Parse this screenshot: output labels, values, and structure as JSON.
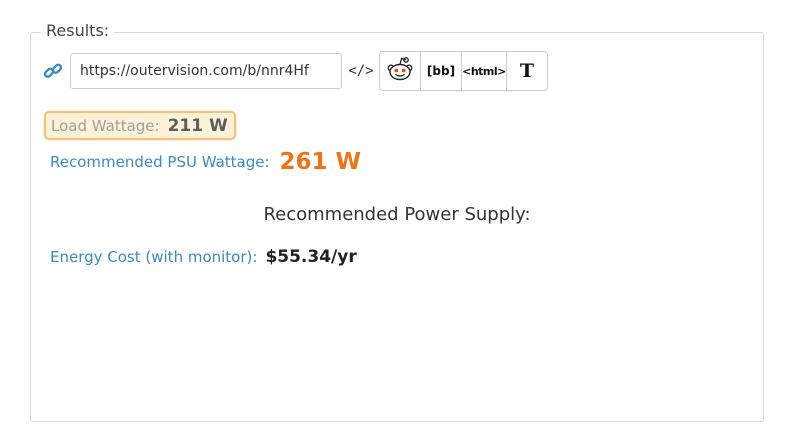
{
  "results": {
    "legend": "Results:",
    "share": {
      "link_icon": "link-icon",
      "url": "https://outervision.com/b/nnr4Hf",
      "embed_label": "</>",
      "buttons": {
        "reddit_icon": "reddit-icon",
        "bbcode_label": "[bb]",
        "html_label": "<html>",
        "text_label": "T"
      }
    },
    "load_wattage": {
      "label": "Load Wattage:",
      "value": "211 W"
    },
    "recommended_psu_wattage": {
      "label": "Recommended PSU Wattage:",
      "value": "261 W"
    },
    "recommended_power_supply": {
      "title": "Recommended Power Supply:"
    },
    "energy_cost": {
      "label": "Energy Cost (with monitor):",
      "value": "$55.34/yr"
    }
  },
  "colors": {
    "accent_blue": "#3a8ac8",
    "psu_orange": "#f07318",
    "highlight_border": "#f1c27d",
    "highlight_bg": "#fdf1d8"
  }
}
